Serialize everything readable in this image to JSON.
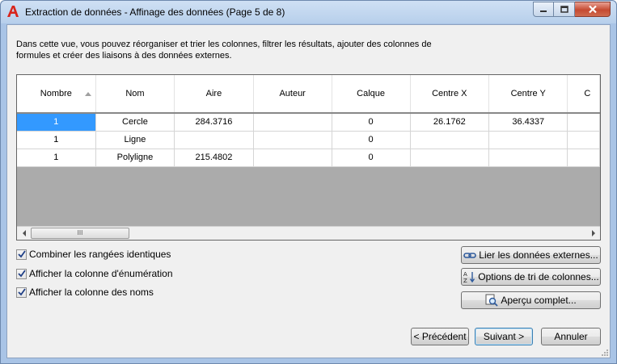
{
  "window": {
    "title": "Extraction de données - Affinage des données (Page 5 de 8)",
    "icon": "autocad-a-icon",
    "controls": {
      "minimize": "minimize-icon",
      "maximize": "maximize-icon",
      "close": "close-icon"
    }
  },
  "description": "Dans cette vue, vous pouvez réorganiser et trier les colonnes, filtrer les résultats, ajouter des colonnes de formules et créer des liaisons à des données externes.",
  "grid": {
    "columns": [
      "Nombre",
      "Nom",
      "Aire",
      "Auteur",
      "Calque",
      "Centre X",
      "Centre Y",
      "C"
    ],
    "sorted_column": "Nombre",
    "rows": [
      {
        "selected": true,
        "cells": [
          "1",
          "Cercle",
          "284.3716",
          "",
          "0",
          "26.1762",
          "36.4337",
          ""
        ]
      },
      {
        "selected": false,
        "cells": [
          "1",
          "Ligne",
          "",
          "",
          "0",
          "",
          "",
          ""
        ]
      },
      {
        "selected": false,
        "cells": [
          "1",
          "Polyligne",
          "215.4802",
          "",
          "0",
          "",
          "",
          ""
        ]
      }
    ],
    "scroll_thumb_grip": "III"
  },
  "options": [
    {
      "label": "Combiner les rangées identiques",
      "checked": true
    },
    {
      "label": "Afficher la colonne d'énumération",
      "checked": true
    },
    {
      "label": "Afficher la colonne des noms",
      "checked": true
    }
  ],
  "side_buttons": {
    "link": {
      "label": "Lier les données externes...",
      "icon": "link-data-icon"
    },
    "sort": {
      "label": "Options de tri de colonnes...",
      "icon": "sort-az-icon"
    },
    "preview": {
      "label": "Aperçu complet...",
      "icon": "preview-magnifier-icon"
    }
  },
  "nav_buttons": {
    "back": "< Précédent",
    "next": "Suivant >",
    "cancel": "Annuler"
  },
  "colors": {
    "selection": "#3399ff",
    "grid_background": "#ababab",
    "title_bar": "#b7cfeb",
    "close_button": "#c54a31"
  }
}
